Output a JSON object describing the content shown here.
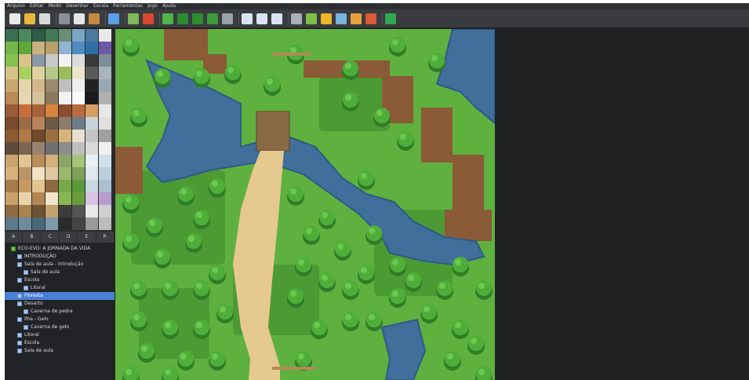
{
  "menu": [
    "Arquivo",
    "Editar",
    "Modo",
    "Desenhar",
    "Escala",
    "Ferramentas",
    "Jogo",
    "Ajuda"
  ],
  "toolbar": [
    {
      "icon": "new-project-icon",
      "color": "#e9e9e9"
    },
    {
      "icon": "open-project-icon",
      "color": "#e8b83a"
    },
    {
      "icon": "save-project-icon",
      "color": "#d9d9d9"
    },
    {
      "sep": true
    },
    {
      "icon": "cut-icon",
      "color": "#8a8f99"
    },
    {
      "icon": "copy-icon",
      "color": "#e6e6e6"
    },
    {
      "icon": "paste-icon",
      "color": "#c48b3f"
    },
    {
      "sep": true
    },
    {
      "icon": "undo-icon",
      "color": "#5aa0e8"
    },
    {
      "sep": true
    },
    {
      "icon": "map-mode-icon",
      "color": "#7fb85a"
    },
    {
      "icon": "event-mode-icon",
      "color": "#d9482f"
    },
    {
      "sep": true
    },
    {
      "icon": "pencil-tool-icon",
      "color": "#4fb54a"
    },
    {
      "icon": "rectangle-tool-icon",
      "color": "#2e8c2e"
    },
    {
      "icon": "ellipse-tool-icon",
      "color": "#2e8c2e"
    },
    {
      "icon": "fill-tool-icon",
      "color": "#3c9c3c"
    },
    {
      "icon": "shadow-pen-icon",
      "color": "#9aa0a8"
    },
    {
      "sep": true
    },
    {
      "icon": "zoom-in-icon",
      "color": "#d8e4f4"
    },
    {
      "icon": "zoom-out-icon",
      "color": "#d8e4f4"
    },
    {
      "icon": "zoom-reset-icon",
      "color": "#d8e4f4"
    },
    {
      "sep": true
    },
    {
      "icon": "database-icon",
      "color": "#a9b0b8"
    },
    {
      "icon": "plugin-manager-icon",
      "color": "#7bc043"
    },
    {
      "icon": "sound-test-icon",
      "color": "#f0b428"
    },
    {
      "icon": "event-searcher-icon",
      "color": "#7ab4e0"
    },
    {
      "icon": "resource-manager-icon",
      "color": "#e6a23c"
    },
    {
      "icon": "character-generator-icon",
      "color": "#d95b35"
    },
    {
      "sep": true
    },
    {
      "icon": "playtest-icon",
      "color": "#2fa84f"
    }
  ],
  "tile_tabs": [
    "A",
    "B",
    "C",
    "D",
    "E",
    "R"
  ],
  "map_tree": [
    {
      "label": "ECO-EVO: A JORNADA DA VIDA",
      "depth": 0,
      "root": true
    },
    {
      "label": "INTRODUÇÃO",
      "depth": 1
    },
    {
      "label": "Sala de aula - Introdução",
      "depth": 1
    },
    {
      "label": "Sala de aula",
      "depth": 2
    },
    {
      "label": "Escola",
      "depth": 1
    },
    {
      "label": "Litoral",
      "depth": 2
    },
    {
      "label": "Floresta",
      "depth": 1,
      "selected": true
    },
    {
      "label": "Deserto",
      "depth": 1
    },
    {
      "label": "Caverna de pedra",
      "depth": 2
    },
    {
      "label": "Ilha - Gelo",
      "depth": 1
    },
    {
      "label": "Caverna de gelo",
      "depth": 2
    },
    {
      "label": "Litoral",
      "depth": 1
    },
    {
      "label": "Escola",
      "depth": 1
    },
    {
      "label": "Sala de aula",
      "depth": 1
    }
  ],
  "colors": {
    "grass": "#5fb13f",
    "grass_dark": "#4c9a34",
    "tree_light": "#4fae3a",
    "tree_dark": "#2f7d27",
    "water": "#3f6f9a",
    "water_edge": "#2f5a85",
    "path": "#e6c98e",
    "cliff": "#8b5a36",
    "selection": "#4a7fd6"
  }
}
